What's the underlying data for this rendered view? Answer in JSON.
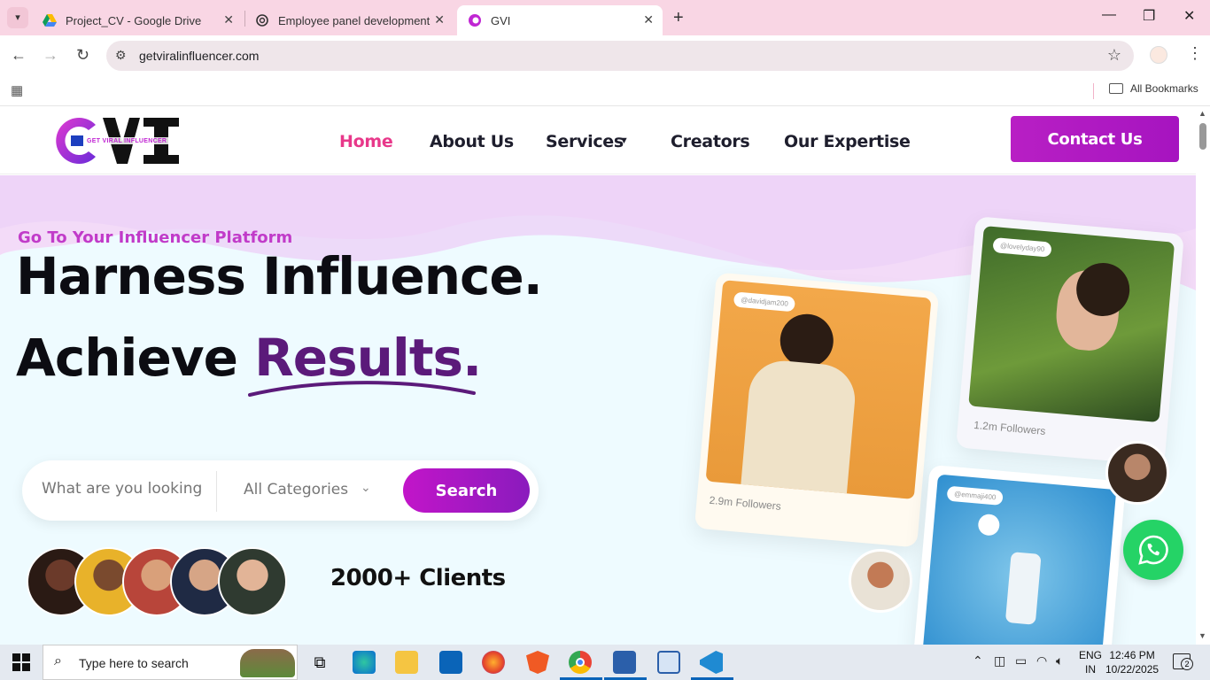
{
  "browser": {
    "tabs": [
      {
        "title": "Project_CV - Google Drive",
        "active": false
      },
      {
        "title": "Employee panel development",
        "active": false
      },
      {
        "title": "GVI",
        "active": true
      }
    ],
    "url": "getviralinfluencer.com",
    "bookmarks_label": "All Bookmarks"
  },
  "site": {
    "logo_text": "GET VIRAL INFLUENCER",
    "nav": {
      "home": "Home",
      "about": "About Us",
      "services": "Services",
      "creators": "Creators",
      "expertise": "Our Expertise"
    },
    "contact_label": "Contact Us"
  },
  "hero": {
    "tagline": "Go To Your Influencer Platform",
    "headline_1": "Harness Influence.",
    "headline_2a": "Achieve ",
    "headline_2b": "Results.",
    "search_placeholder": "What are you looking for",
    "category_label": "All Categories",
    "search_button": "Search",
    "clients_label": "2000+ Clients"
  },
  "cards": [
    {
      "handle": "@davidjam200",
      "followers": "2.9m Followers"
    },
    {
      "handle": "@lovelyday90",
      "followers": "1.2m Followers"
    },
    {
      "handle": "@emmaji400",
      "followers": ""
    }
  ],
  "taskbar": {
    "search_placeholder": "Type here to search",
    "lang_1": "ENG",
    "lang_2": "IN",
    "time": "12:46 PM",
    "date": "10/22/2025",
    "notifications": "2"
  },
  "colors": {
    "accent_pink": "#e8388a",
    "brand_purple": "#b81fc4",
    "results_purple": "#5b1a7a",
    "whatsapp_green": "#25d366"
  }
}
